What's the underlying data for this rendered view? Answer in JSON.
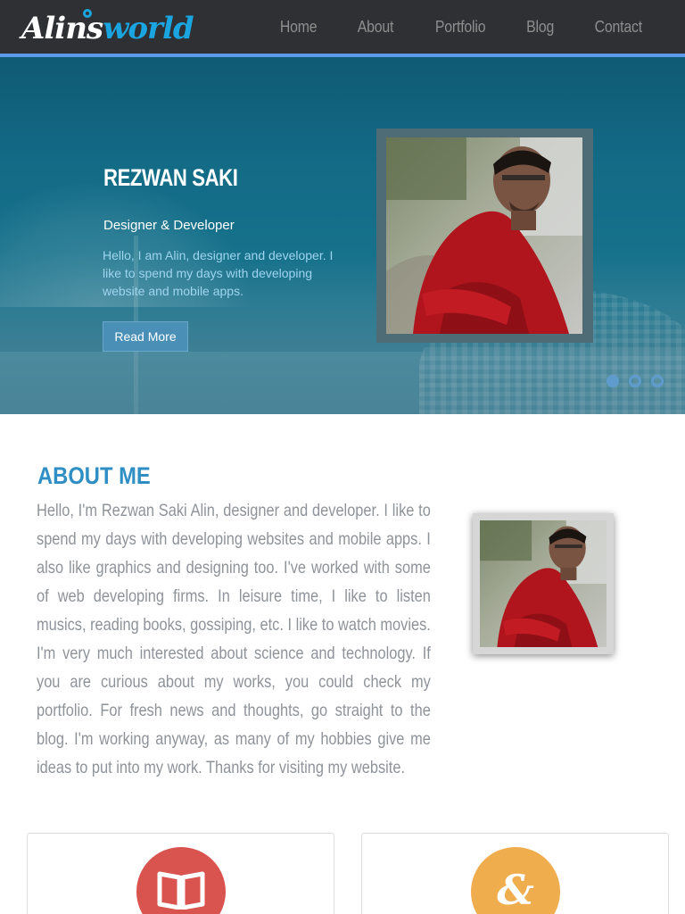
{
  "brand": {
    "logo_part1": "Alins",
    "logo_part2": "world"
  },
  "nav": {
    "items": [
      {
        "label": "Home"
      },
      {
        "label": "About"
      },
      {
        "label": "Portfolio"
      },
      {
        "label": "Blog"
      },
      {
        "label": "Contact"
      }
    ]
  },
  "hero": {
    "name": "REZWAN SAKI",
    "role": "Designer & Developer",
    "description": "Hello, I am Alin, designer and developer. I like to spend my days with developing website and mobile apps.",
    "button_label": "Read More",
    "slides": {
      "count": 3,
      "active": 1
    }
  },
  "about": {
    "title": "ABOUT ME",
    "body": "Hello, I'm Rezwan Saki Alin, designer and developer. I like to spend my days with developing websites and mobile apps. I also like graphics and designing too. I've worked with some of web developing firms. In leisure time, I like to listen musics, reading books, gossiping, etc. I like to watch movies. I'm very much interested about science and technology. If you are curious about my works, you could check my portfolio. For fresh news and thoughts, go straight to the blog. I'm working anyway, as many of my hobbies give me ideas to put into my work. Thanks for visiting my website."
  },
  "cards": [
    {
      "icon": "book-icon",
      "color": "#d9534f"
    },
    {
      "icon": "ampersand-icon",
      "glyph": "&",
      "color": "#f0ad4e"
    }
  ],
  "colors": {
    "navbar": "#2f3033",
    "accent_line": "#5b9bea",
    "logo_accent": "#1aa5e0",
    "about_title": "#2f8fc4",
    "button": "#4a8fb6"
  }
}
